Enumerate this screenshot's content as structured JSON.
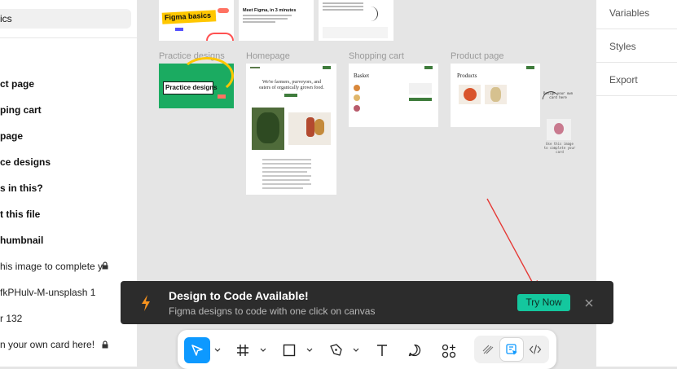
{
  "left_panel": {
    "selected_page": "ics",
    "layers": [
      {
        "label": "ct page",
        "weight": "bold",
        "locked": false
      },
      {
        "label": "ping cart",
        "weight": "bold",
        "locked": false
      },
      {
        "label": "page",
        "weight": "bold",
        "locked": false
      },
      {
        "label": "ce designs",
        "weight": "bold",
        "locked": false
      },
      {
        "label": "s in this?",
        "weight": "bold",
        "locked": false
      },
      {
        "label": "t this file",
        "weight": "bold",
        "locked": false
      },
      {
        "label": "humbnail",
        "weight": "bold",
        "locked": false
      },
      {
        "label": "his image to complete y",
        "weight": "normal",
        "locked": true
      },
      {
        "label": "fkPHulv-M-unsplash 1",
        "weight": "normal",
        "locked": false
      },
      {
        "label": "r 132",
        "weight": "normal",
        "locked": false
      },
      {
        "label": "n your own card here!",
        "weight": "normal",
        "locked": true
      }
    ]
  },
  "canvas": {
    "frame_labels": [
      "Practice designs",
      "Homepage",
      "Shopping cart",
      "Product page"
    ],
    "figma_basics": "Figma basics",
    "meet_figma": "Meet Figma, in 3 minutes",
    "practice_designs_badge": "Practice designs",
    "homepage_headline": "We're farmers, purveyors, and eaters of organically grown food.",
    "cart_heading": "Basket",
    "product_heading": "Products",
    "design_own_card": "Design your own card here",
    "use_image": "Use this image to complete your card"
  },
  "right_panel": {
    "tabs": [
      "Variables",
      "Styles",
      "Export"
    ]
  },
  "toast": {
    "title": "Design to Code Available!",
    "subtitle": "Figma designs to code with one click on canvas",
    "button": "Try Now",
    "accent": "#14c79e",
    "bolt_color": "#f7931e"
  },
  "toolbar": {
    "tools": [
      "move-tool",
      "frame-tool",
      "shape-tool",
      "pen-tool",
      "text-tool",
      "comment-tool",
      "actions-tool"
    ],
    "modes": [
      "draw-mode",
      "design-mode",
      "dev-mode"
    ],
    "active_color": "#0d99ff"
  }
}
